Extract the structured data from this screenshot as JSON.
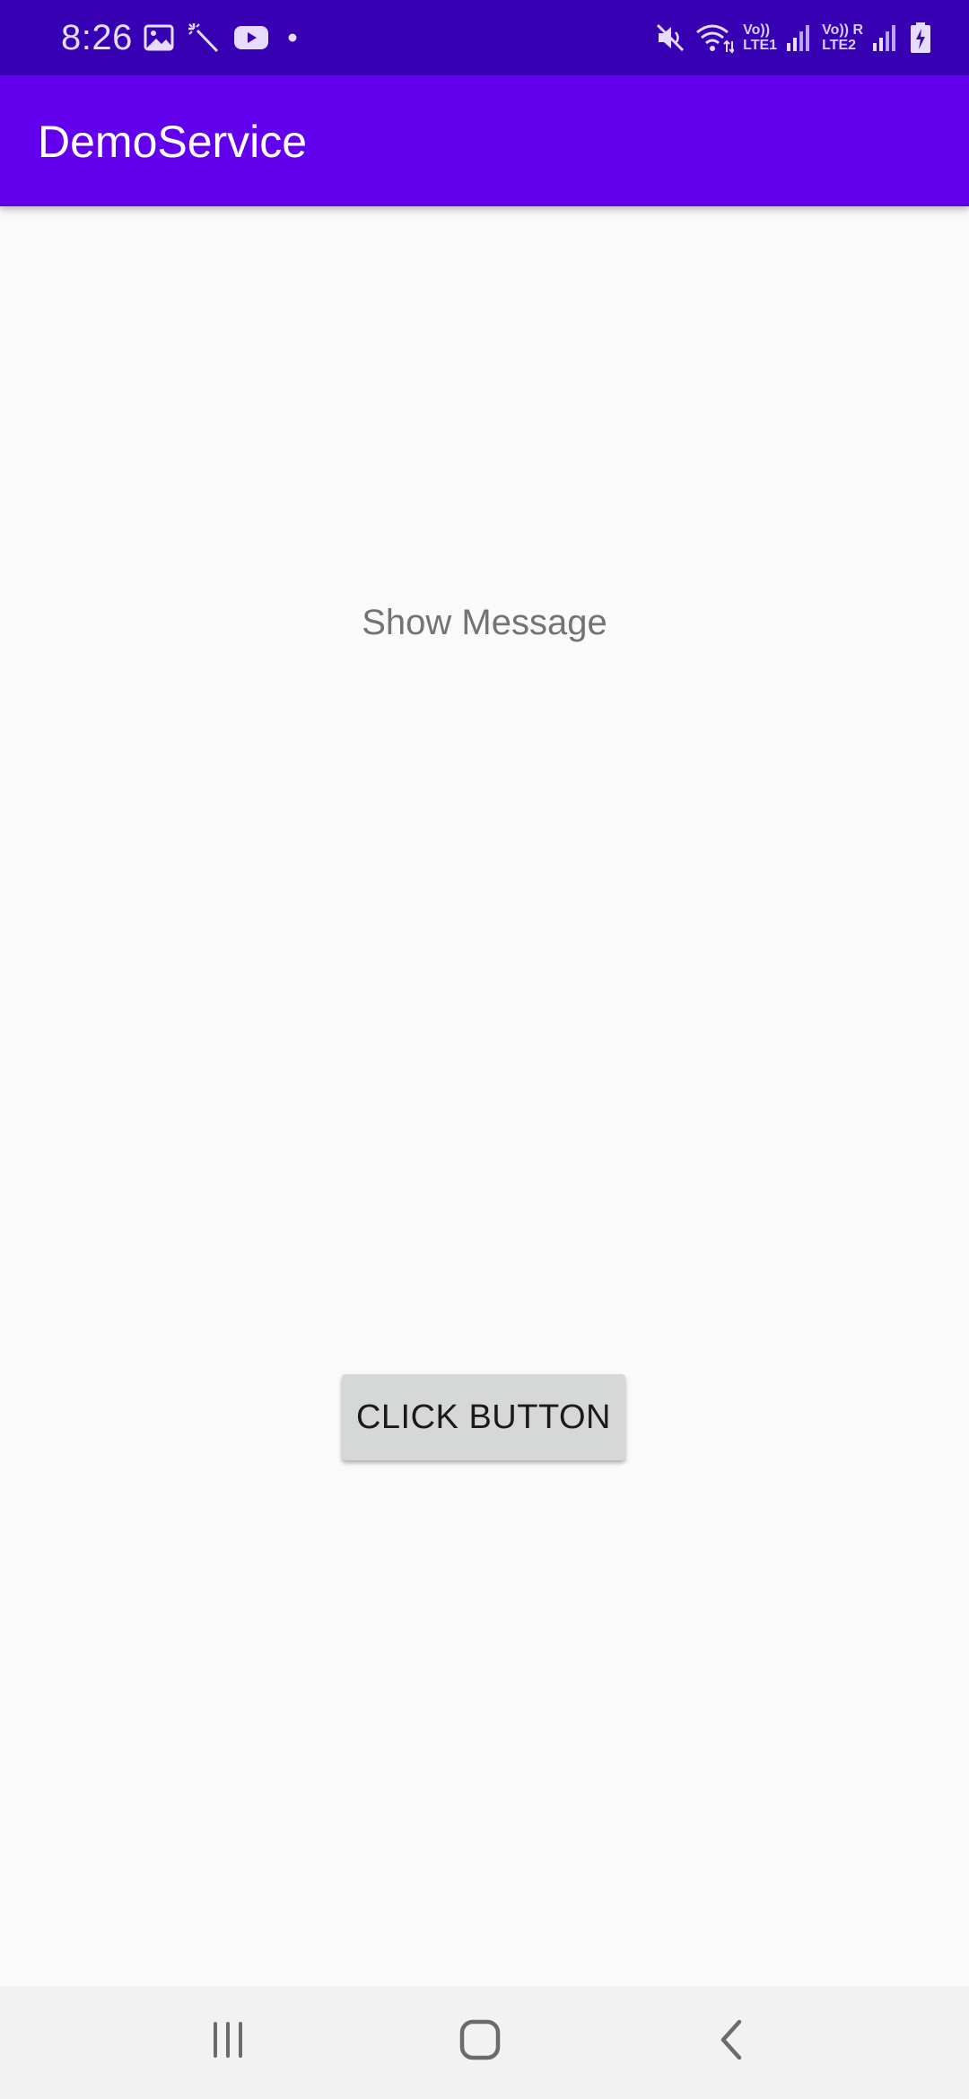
{
  "status_bar": {
    "time": "8:26",
    "left_icons": [
      "gallery-icon",
      "magic-wand-icon",
      "youtube-icon",
      "notification-dot-icon"
    ],
    "right_icons": [
      "mute-icon",
      "wifi-icon",
      "signal-sim1-icon",
      "signal-sim2-icon",
      "battery-charging-icon"
    ],
    "sim1_top": "Vo))",
    "sim1_bottom": "LTE1",
    "sim2_top": "Vo)) R",
    "sim2_bottom": "LTE2",
    "battery_level": "7"
  },
  "app_bar": {
    "title": "DemoService",
    "color": "#6200ee",
    "status_color": "#3700b3"
  },
  "content": {
    "message": "Show Message",
    "button_label": "CLICK BUTTON"
  },
  "nav_bar": {
    "buttons": [
      "recent-apps-icon",
      "home-icon",
      "back-icon"
    ]
  }
}
